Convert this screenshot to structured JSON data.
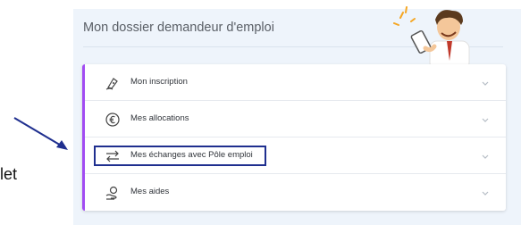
{
  "panel": {
    "title": "Mon dossier demandeur d'emploi"
  },
  "rows": [
    {
      "label": "Mon inscription",
      "icon": "signature-pen-icon"
    },
    {
      "label": "Mes allocations",
      "icon": "euro-coin-icon"
    },
    {
      "label": "Mes échanges avec Pôle emploi",
      "icon": "exchange-arrows-icon"
    },
    {
      "label": "Mes aides",
      "icon": "helping-hand-icon"
    }
  ],
  "side_text": "let",
  "colors": {
    "accent": "#a24cf2",
    "highlight_border": "#1f2f8f",
    "panel_bg": "#eef4fb"
  }
}
